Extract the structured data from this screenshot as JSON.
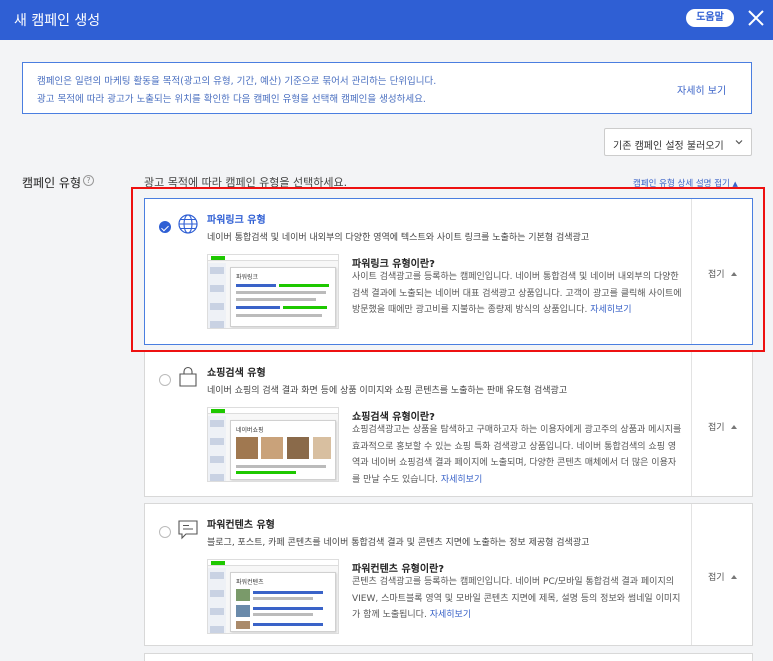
{
  "header": {
    "title": "새 캠페인 생성",
    "help_label": "도움말"
  },
  "info": {
    "line1": "캠페인은 일련의 마케팅 활동을 목적(광고의 유형, 기간, 예산) 기준으로 묶어서 관리하는 단위입니다.",
    "line2": "광고 목적에 따라 광고가 노출되는 위치를 확인한 다음 캠페인 유형을 선택해 캠페인을 생성하세요.",
    "more_label": "자세히 보기"
  },
  "load_settings": {
    "label": "기존 캠페인 설정 불러오기"
  },
  "section": {
    "label": "캠페인 유형",
    "desc": "광고 목적에 따라 캠페인 유형을 선택하세요.",
    "detail_link": "캠페인 유형 상세 설명 접기"
  },
  "campaign_types": [
    {
      "name": "파워링크 유형",
      "desc": "네이버 통합검색 및 네이버 내외부의 다양한 영역에 텍스트와 사이트 링크를 노출하는 기본형 검색광고",
      "what_title": "파워링크 유형이란?",
      "what_body": "사이트 검색광고를 등록하는 캠페인입니다. 네이버 통합검색 및 네이버 내외부의 다양한 검색 결과에 노출되는 네이버 대표 검색광고 상품입니다. 고객이 광고를 클릭해 사이트에 방문했을 때에만 광고비를 지불하는 종량제 방식의 상품입니다.",
      "link": "자세히보기",
      "fold": "접기",
      "selected": true,
      "thumb_title": "파워링크"
    },
    {
      "name": "쇼핑검색 유형",
      "desc": "네이버 쇼핑의 검색 결과 화면 등에 상품 이미지와 쇼핑 콘텐츠를 노출하는 판매 유도형 검색광고",
      "what_title": "쇼핑검색 유형이란?",
      "what_body": "쇼핑검색광고는 상품을 탐색하고 구매하고자 하는 이용자에게 광고주의 상품과 메시지를 효과적으로 홍보할 수 있는 쇼핑 특화 검색광고 상품입니다. 네이버 통합검색의 쇼핑 영역과 네이버 쇼핑검색 결과 페이지에 노출되며, 다양한 콘텐츠 매체에서 더 많은 이용자를 만날 수도 있습니다.",
      "link": "자세히보기",
      "fold": "접기",
      "selected": false,
      "thumb_title": "네이버쇼핑"
    },
    {
      "name": "파워컨텐츠 유형",
      "desc": "블로그, 포스트, 카페 콘텐츠를 네이버 통합검색 결과 및 콘텐츠 지면에 노출하는 정보 제공형 검색광고",
      "what_title": "파워컨텐츠 유형이란?",
      "what_body": "콘텐츠 검색광고를 등록하는 캠페인입니다. 네이버 PC/모바일 통합검색 결과 페이지의 VIEW, 스마트블록 영역 및 모바일 콘텐츠 지면에 제목, 설명 등의 정보와 썸네일 이미지가 함께 노출됩니다.",
      "link": "자세히보기",
      "fold": "접기",
      "selected": false,
      "thumb_title": "파워컨텐츠"
    }
  ],
  "colors": {
    "header_bg": "#2f5fd4",
    "accent": "#2f5fd4",
    "highlight": "#ee1111",
    "link": "#3a63c8"
  },
  "icons": {
    "close": "close-icon",
    "help": "question-icon",
    "dropdown": "chevron-down-icon",
    "powerlink": "globe-icon",
    "shopping": "shopping-bag-icon",
    "powercontents": "chat-document-icon"
  }
}
